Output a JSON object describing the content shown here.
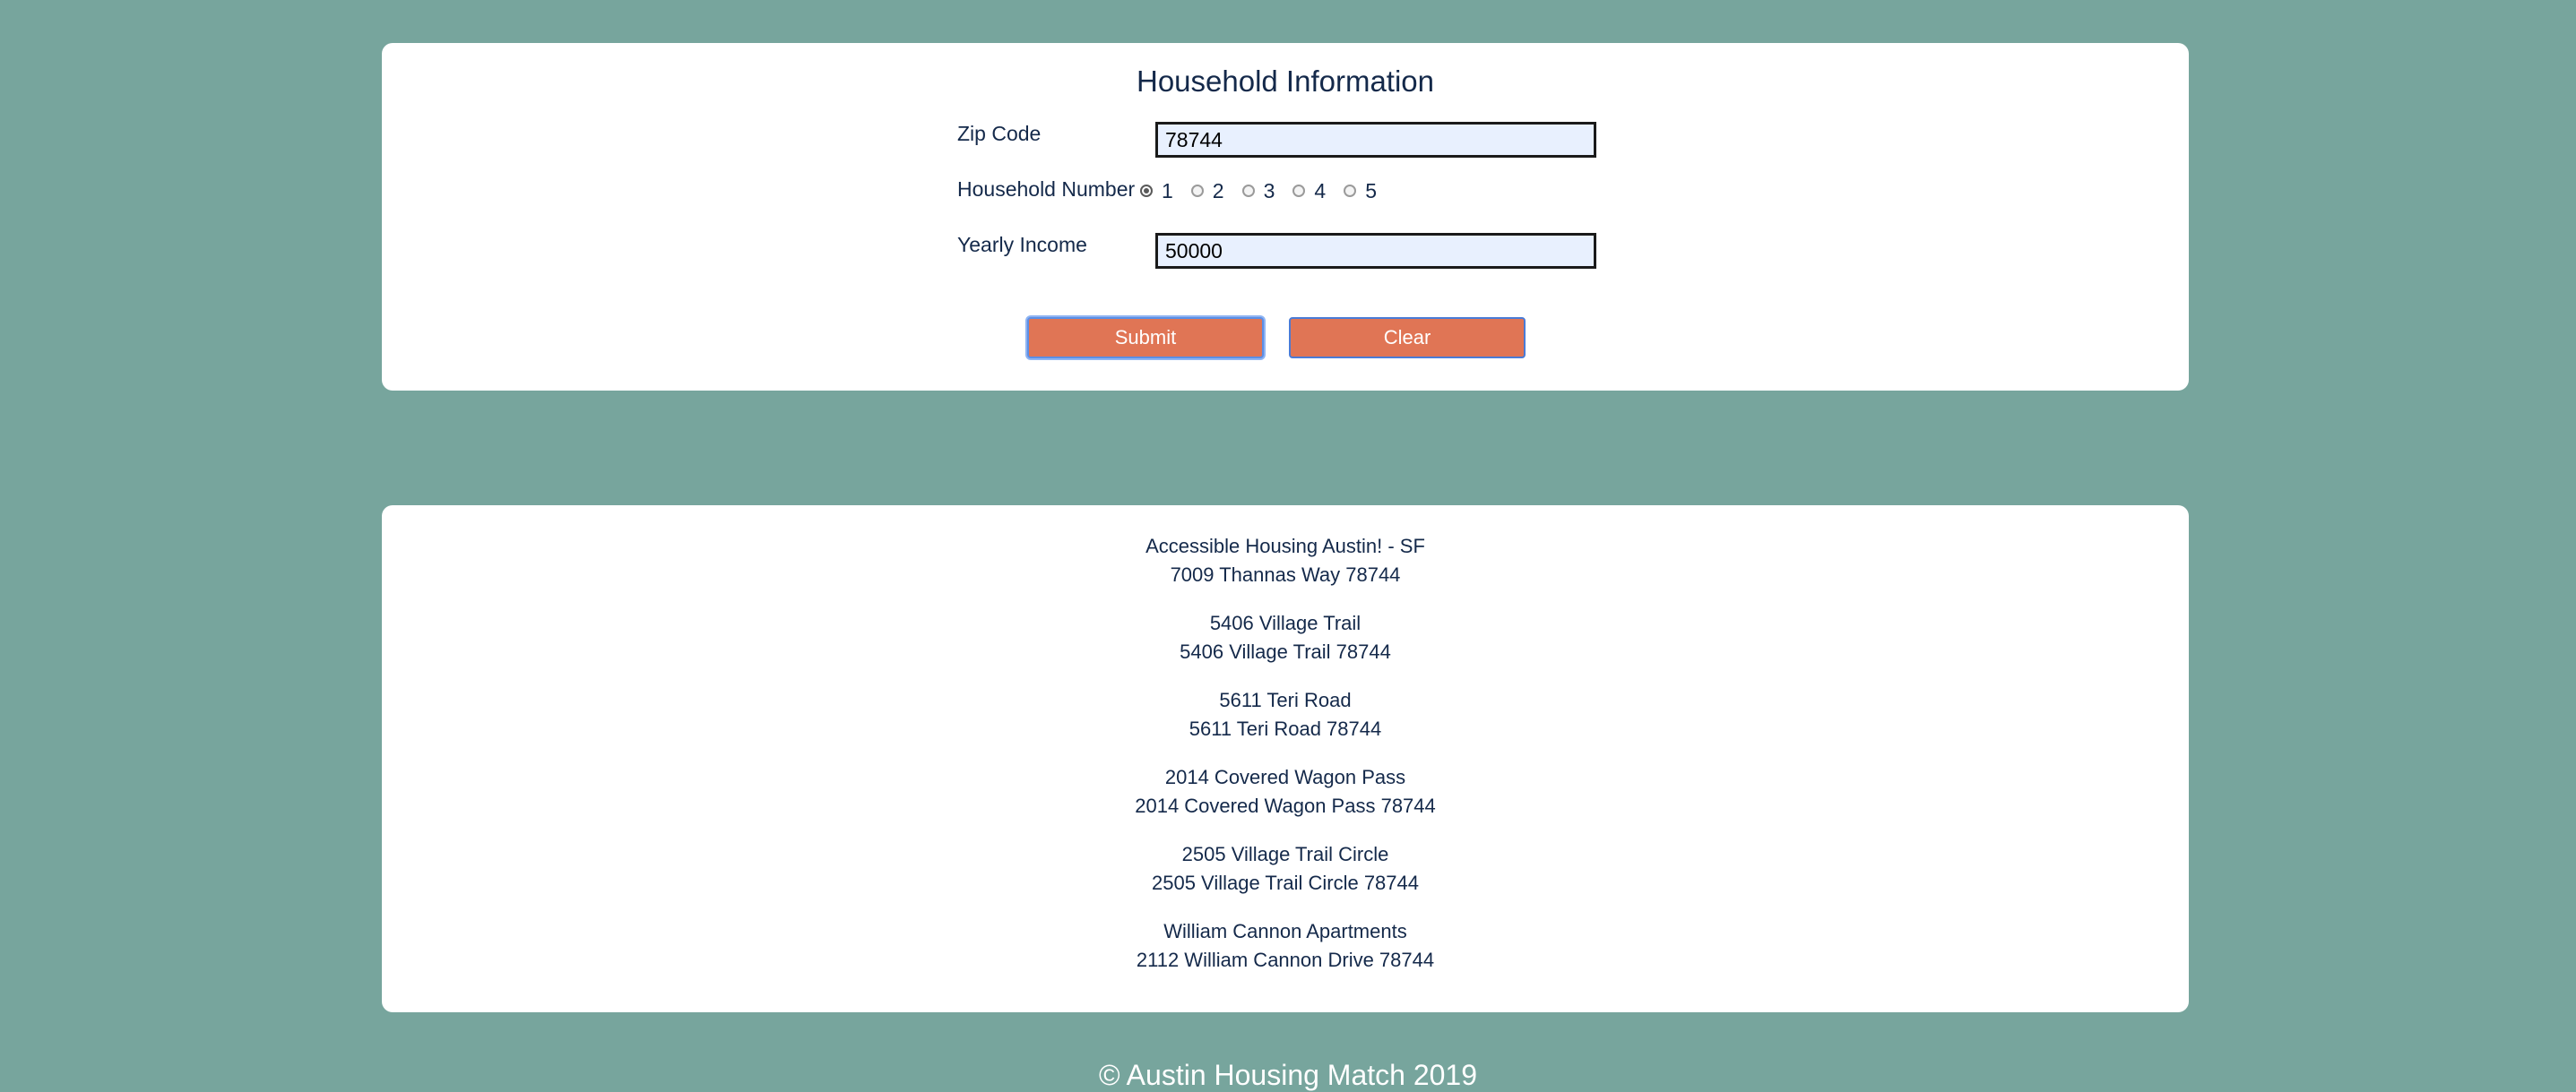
{
  "form": {
    "title": "Household Information",
    "zip": {
      "label": "Zip Code",
      "value": "78744"
    },
    "household": {
      "label": "Household Number",
      "options": [
        "1",
        "2",
        "3",
        "4",
        "5"
      ],
      "selected": "1"
    },
    "income": {
      "label": "Yearly Income",
      "value": "50000"
    },
    "submit_label": "Submit",
    "clear_label": "Clear"
  },
  "results": [
    {
      "name": "Accessible Housing Austin! - SF",
      "address": "7009 Thannas Way 78744"
    },
    {
      "name": "5406 Village Trail",
      "address": "5406 Village Trail 78744"
    },
    {
      "name": "5611 Teri Road",
      "address": "5611 Teri Road 78744"
    },
    {
      "name": "2014 Covered Wagon Pass",
      "address": "2014 Covered Wagon Pass 78744"
    },
    {
      "name": "2505 Village Trail Circle",
      "address": "2505 Village Trail Circle 78744"
    },
    {
      "name": "William Cannon Apartments",
      "address": "2112 William Cannon Drive 78744"
    }
  ],
  "footer": {
    "text": "© Austin Housing Match 2019"
  },
  "colors": {
    "background": "#77a59d",
    "button": "#e07555",
    "text": "#14294a",
    "input_bg": "#e8f0fe"
  }
}
